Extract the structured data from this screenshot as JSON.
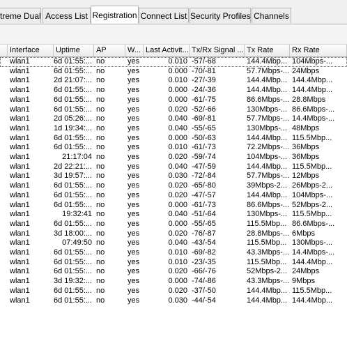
{
  "tabs": [
    {
      "label": "treme Dual",
      "active": false
    },
    {
      "label": "Access List",
      "active": false
    },
    {
      "label": "Registration",
      "active": true
    },
    {
      "label": "Connect List",
      "active": false
    },
    {
      "label": "Security Profiles",
      "active": false
    },
    {
      "label": "Channels",
      "active": false
    }
  ],
  "table": {
    "columns": [
      "Interface",
      "Uptime",
      "AP",
      "W...",
      "Last Activit...",
      "Tx/Rx Signal ...",
      "Tx Rate",
      "Rx Rate"
    ],
    "rows": [
      [
        "wlan1",
        "6d 01:55:...",
        "no",
        "yes",
        "0.010",
        "-57/-68",
        "144.4Mbp...",
        "104Mbps-..."
      ],
      [
        "wlan1",
        "6d 01:55:...",
        "no",
        "yes",
        "0.000",
        "-70/-81",
        "57.7Mbps-...",
        "24Mbps"
      ],
      [
        "wlan1",
        "2d 21:07:...",
        "no",
        "yes",
        "0.010",
        "-27/-39",
        "144.4Mbp...",
        "144.4Mbp..."
      ],
      [
        "wlan1",
        "6d 01:55:...",
        "no",
        "yes",
        "0.000",
        "-24/-36",
        "144.4Mbp...",
        "144.4Mbp..."
      ],
      [
        "wlan1",
        "6d 01:55:...",
        "no",
        "yes",
        "0.000",
        "-61/-75",
        "86.6Mbps-...",
        "28.8Mbps"
      ],
      [
        "wlan1",
        "6d 01:55:...",
        "no",
        "yes",
        "0.020",
        "-52/-66",
        "130Mbps-...",
        "86.6Mbps-..."
      ],
      [
        "wlan1",
        "2d 05:26:...",
        "no",
        "yes",
        "0.040",
        "-69/-81",
        "57.7Mbps-...",
        "14.4Mbps-..."
      ],
      [
        "wlan1",
        "1d 19:34:...",
        "no",
        "yes",
        "0.040",
        "-55/-65",
        "130Mbps-...",
        "48Mbps"
      ],
      [
        "wlan1",
        "6d 01:55:...",
        "no",
        "yes",
        "0.000",
        "-50/-63",
        "144.4Mbp...",
        "115.5Mbp..."
      ],
      [
        "wlan1",
        "6d 01:55:...",
        "no",
        "yes",
        "0.010",
        "-61/-73",
        "72.2Mbps-...",
        "36Mbps"
      ],
      [
        "wlan1",
        "21:17:04",
        "no",
        "yes",
        "0.020",
        "-59/-74",
        "104Mbps-...",
        "36Mbps"
      ],
      [
        "wlan1",
        "2d 22:21:...",
        "no",
        "yes",
        "0.040",
        "-47/-59",
        "144.4Mbp...",
        "115.5Mbp..."
      ],
      [
        "wlan1",
        "3d 19:57:...",
        "no",
        "yes",
        "0.030",
        "-72/-84",
        "57.7Mbps-...",
        "12Mbps"
      ],
      [
        "wlan1",
        "6d 01:55:...",
        "no",
        "yes",
        "0.020",
        "-65/-80",
        "39Mbps-2...",
        "26Mbps-2..."
      ],
      [
        "wlan1",
        "6d 01:55:...",
        "no",
        "yes",
        "0.020",
        "-47/-57",
        "144.4Mbp...",
        "104Mbps-..."
      ],
      [
        "wlan1",
        "6d 01:55:...",
        "no",
        "yes",
        "0.000",
        "-61/-73",
        "86.6Mbps-...",
        "52Mbps-2..."
      ],
      [
        "wlan1",
        "19:32:41",
        "no",
        "yes",
        "0.040",
        "-51/-64",
        "130Mbps-...",
        "115.5Mbp..."
      ],
      [
        "wlan1",
        "6d 01:55:...",
        "no",
        "yes",
        "0.000",
        "-55/-65",
        "115.5Mbp...",
        "86.6Mbps-..."
      ],
      [
        "wlan1",
        "3d 18:00:...",
        "no",
        "yes",
        "0.020",
        "-76/-87",
        "28.8Mbps-...",
        "6Mbps"
      ],
      [
        "wlan1",
        "07:49:50",
        "no",
        "yes",
        "0.040",
        "-43/-54",
        "115.5Mbp...",
        "130Mbps-..."
      ],
      [
        "wlan1",
        "6d 01:55:...",
        "no",
        "yes",
        "0.010",
        "-69/-82",
        "43.3Mbps-...",
        "14.4Mbps-..."
      ],
      [
        "wlan1",
        "6d 01:55:...",
        "no",
        "yes",
        "0.010",
        "-23/-35",
        "115.5Mbp...",
        "144.4Mbp..."
      ],
      [
        "wlan1",
        "6d 01:55:...",
        "no",
        "yes",
        "0.020",
        "-66/-76",
        "52Mbps-2...",
        "24Mbps"
      ],
      [
        "wlan1",
        "3d 19:32:...",
        "no",
        "yes",
        "0.000",
        "-74/-86",
        "43.3Mbps-...",
        "9Mbps"
      ],
      [
        "wlan1",
        "6d 01:55:...",
        "no",
        "yes",
        "0.020",
        "-37/-50",
        "144.4Mbp...",
        "115.5Mbp..."
      ],
      [
        "wlan1",
        "6d 01:55:...",
        "no",
        "yes",
        "0.030",
        "-44/-54",
        "144.4Mbp...",
        "144.4Mbp..."
      ]
    ]
  }
}
